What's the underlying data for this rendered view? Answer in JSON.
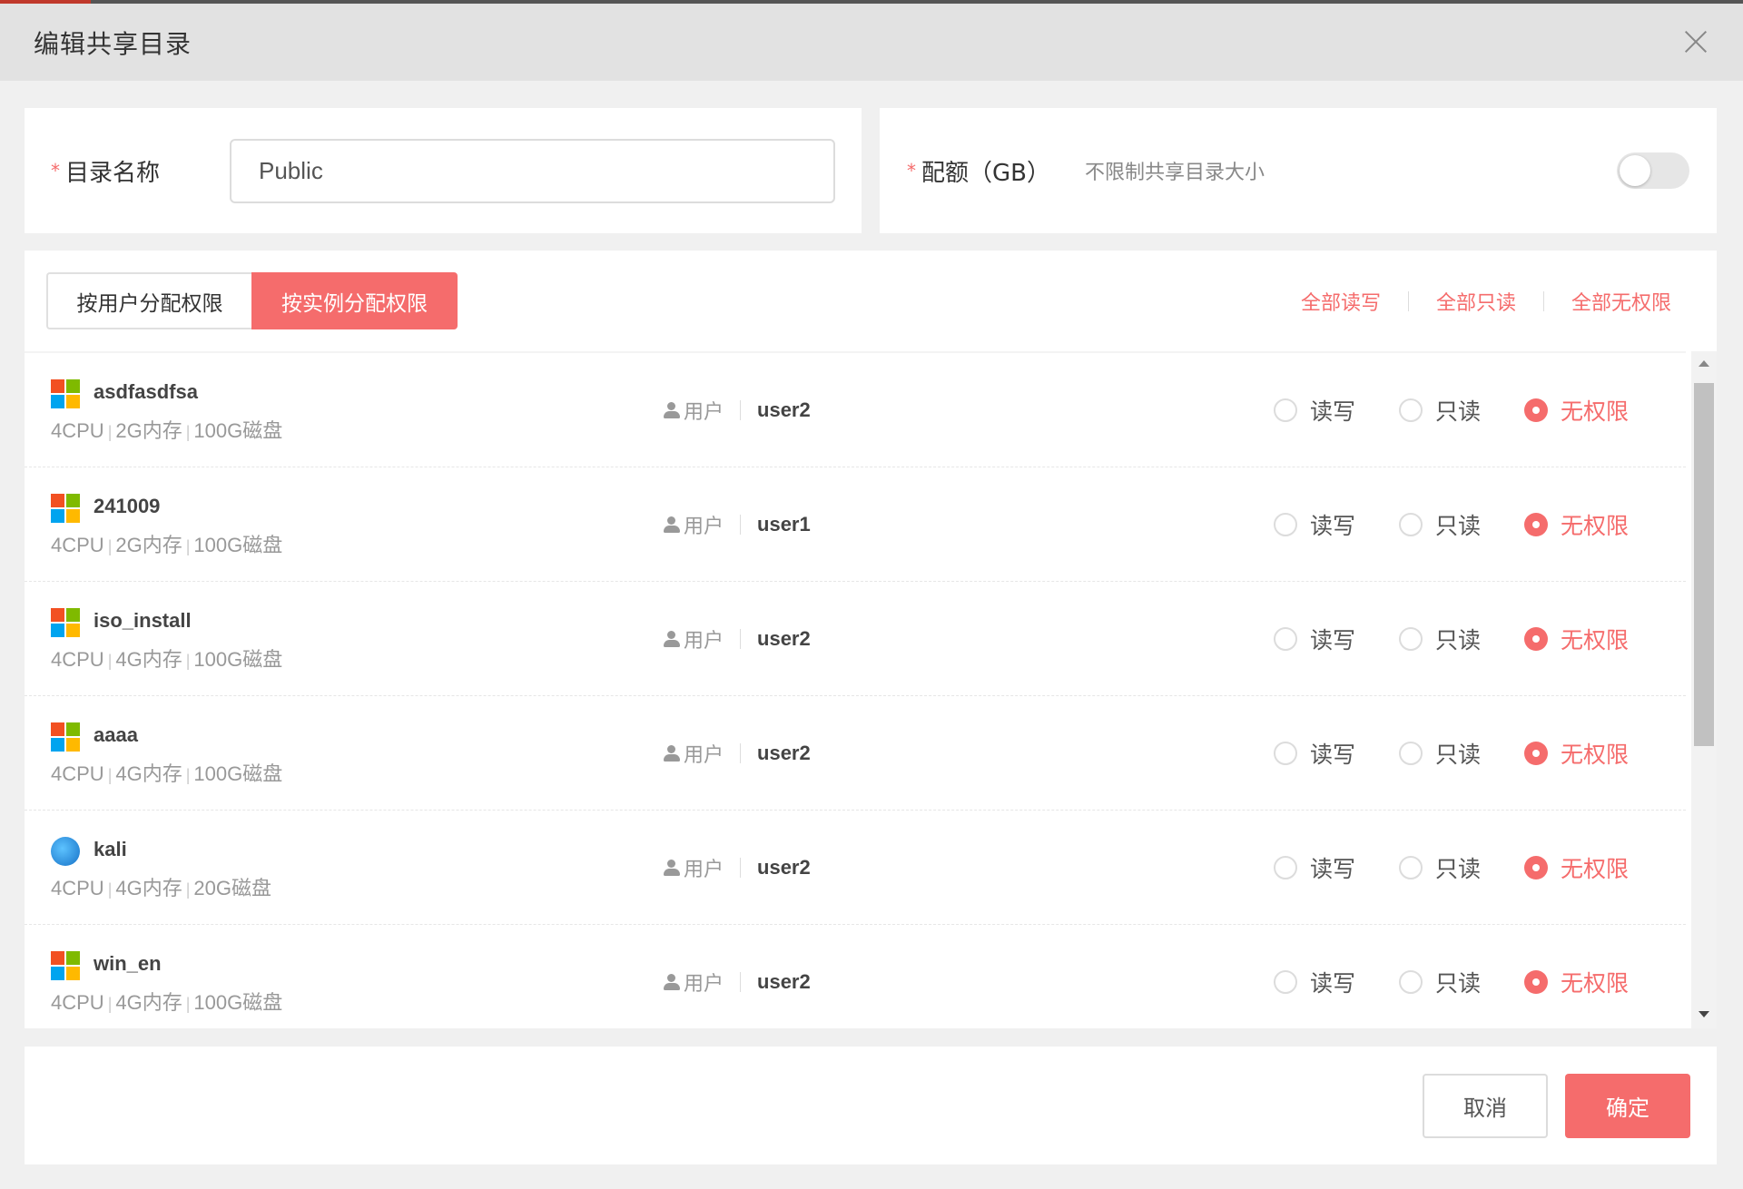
{
  "dialog": {
    "title": "编辑共享目录"
  },
  "name_field": {
    "required_mark": "*",
    "label": "目录名称",
    "value": "Public"
  },
  "quota": {
    "required_mark": "*",
    "label": "配额（GB）",
    "hint": "不限制共享目录大小",
    "unlimited_toggle_on": false
  },
  "tabs": [
    {
      "label": "按用户分配权限",
      "active": false
    },
    {
      "label": "按实例分配权限",
      "active": true
    }
  ],
  "bulk_actions": {
    "all_read_write": "全部读写",
    "all_read_only": "全部只读",
    "all_no_permission": "全部无权限"
  },
  "owner_label": "用户",
  "permission_options": {
    "read_write": "读写",
    "read_only": "只读",
    "none": "无权限"
  },
  "instances": [
    {
      "name": "asdfasdfsa",
      "os_icon": "windows-icon",
      "cpu": "4CPU",
      "memory": "2G内存",
      "disk": "100G磁盘",
      "owner": "user2",
      "permission": "none"
    },
    {
      "name": "241009",
      "os_icon": "windows-icon",
      "cpu": "4CPU",
      "memory": "2G内存",
      "disk": "100G磁盘",
      "owner": "user1",
      "permission": "none"
    },
    {
      "name": "iso_install",
      "os_icon": "windows-icon",
      "cpu": "4CPU",
      "memory": "4G内存",
      "disk": "100G磁盘",
      "owner": "user2",
      "permission": "none"
    },
    {
      "name": "aaaa",
      "os_icon": "windows-icon",
      "cpu": "4CPU",
      "memory": "4G内存",
      "disk": "100G磁盘",
      "owner": "user2",
      "permission": "none"
    },
    {
      "name": "kali",
      "os_icon": "kali-icon",
      "cpu": "4CPU",
      "memory": "4G内存",
      "disk": "20G磁盘",
      "owner": "user2",
      "permission": "none"
    },
    {
      "name": "win_en",
      "os_icon": "windows-icon",
      "cpu": "4CPU",
      "memory": "4G内存",
      "disk": "100G磁盘",
      "owner": "user2",
      "permission": "none"
    }
  ],
  "footer": {
    "cancel": "取消",
    "confirm": "确定"
  },
  "colors": {
    "accent": "#f56c6c",
    "header_bg": "#e2e2e2",
    "page_bg": "#f0f0f0"
  }
}
